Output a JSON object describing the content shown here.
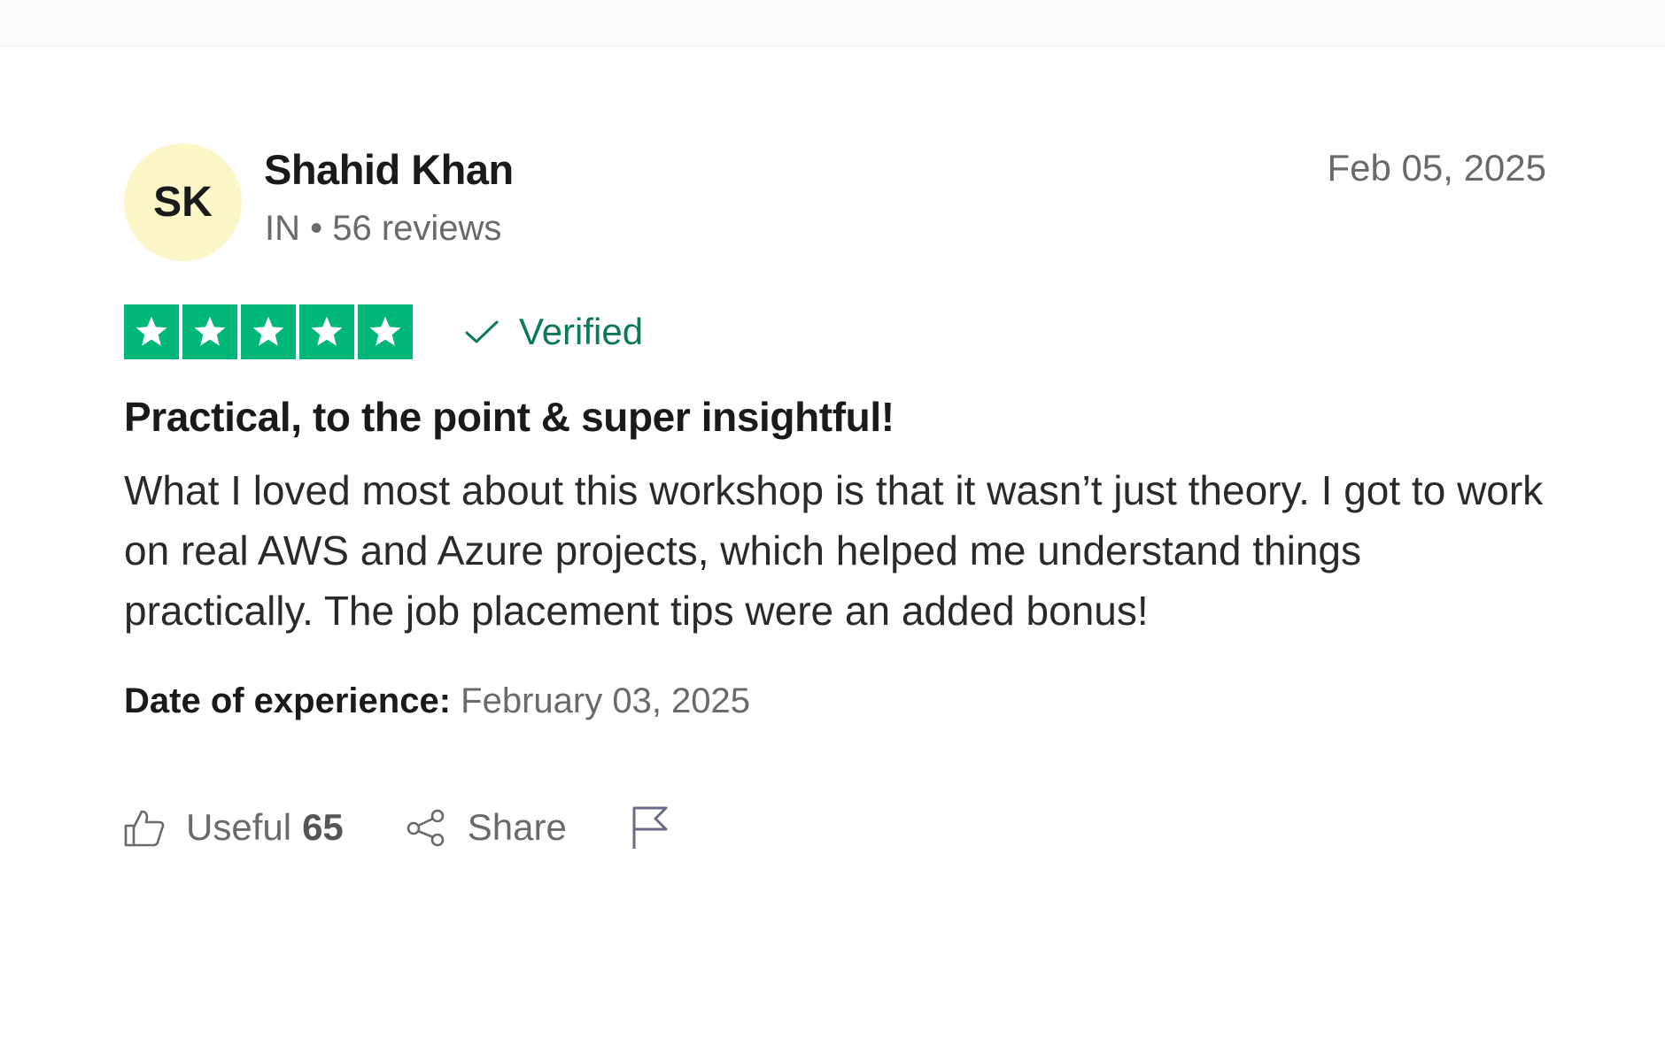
{
  "review": {
    "reviewer": {
      "initials": "SK",
      "name": "Shahid Khan",
      "meta": "IN • 56 reviews"
    },
    "date": "Feb 05, 2025",
    "rating": 5,
    "verified_label": "Verified",
    "title": "Practical, to the point & super insightful!",
    "body": "What I loved most about this workshop is that it wasn’t just theory. I got to work on real AWS and Azure projects, which helped me understand things practically. The job placement tips were an added bonus!",
    "experience_label": "Date of experience:",
    "experience_date": "February 03, 2025"
  },
  "actions": {
    "useful_label": "Useful",
    "useful_count": "65",
    "share_label": "Share"
  },
  "colors": {
    "star_green": "#00b67a",
    "verified_green": "#0e7a55",
    "avatar_bg": "#fdf6c8"
  },
  "icons": {
    "star": "star-icon",
    "check": "checkmark-icon",
    "useful": "thumbs-up-icon",
    "share": "share-icon",
    "flag": "flag-icon"
  }
}
